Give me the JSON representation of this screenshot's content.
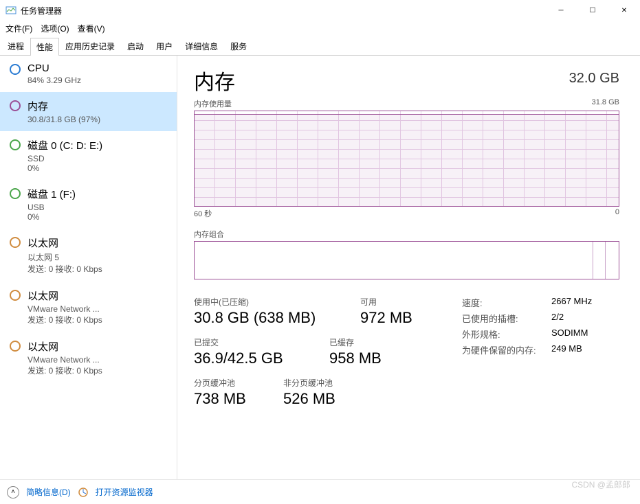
{
  "window": {
    "title": "任务管理器"
  },
  "menu": {
    "file": "文件(F)",
    "options": "选项(O)",
    "view": "查看(V)"
  },
  "tabs": [
    "进程",
    "性能",
    "应用历史记录",
    "启动",
    "用户",
    "详细信息",
    "服务"
  ],
  "active_tab": 1,
  "sidebar": [
    {
      "ind": "blue",
      "title": "CPU",
      "sub": "84% 3.29 GHz"
    },
    {
      "ind": "purple",
      "title": "内存",
      "sub": "30.8/31.8 GB (97%)"
    },
    {
      "ind": "green",
      "title": "磁盘 0 (C: D: E:)",
      "sub": "SSD",
      "sub2": "0%"
    },
    {
      "ind": "green",
      "title": "磁盘 1 (F:)",
      "sub": "USB",
      "sub2": "0%"
    },
    {
      "ind": "orange",
      "title": "以太网",
      "sub": "以太网 5",
      "sub2": "发送: 0 接收: 0 Kbps"
    },
    {
      "ind": "orange",
      "title": "以太网",
      "sub": "VMware Network ...",
      "sub2": "发送: 0 接收: 0 Kbps"
    },
    {
      "ind": "orange",
      "title": "以太网",
      "sub": "VMware Network ...",
      "sub2": "发送: 0 接收: 0 Kbps"
    }
  ],
  "selected_sidebar": 1,
  "main": {
    "title": "内存",
    "total": "32.0 GB",
    "usage_label": "内存使用量",
    "usage_max": "31.8 GB",
    "x_left": "60 秒",
    "x_right": "0",
    "comp_label": "内存组合",
    "stats": {
      "in_use_label": "使用中(已压缩)",
      "in_use": "30.8 GB (638 MB)",
      "available_label": "可用",
      "available": "972 MB",
      "committed_label": "已提交",
      "committed": "36.9/42.5 GB",
      "cached_label": "已缓存",
      "cached": "958 MB",
      "paged_label": "分页缓冲池",
      "paged": "738 MB",
      "nonpaged_label": "非分页缓冲池",
      "nonpaged": "526 MB"
    },
    "info": {
      "speed_l": "速度:",
      "speed_v": "2667 MHz",
      "slots_l": "已使用的插槽:",
      "slots_v": "2/2",
      "form_l": "外形规格:",
      "form_v": "SODIMM",
      "reserved_l": "为硬件保留的内存:",
      "reserved_v": "249 MB"
    }
  },
  "footer": {
    "brief": "简略信息(D)",
    "monitor": "打开资源监视器"
  },
  "watermark": "CSDN @孟郎郎",
  "chart_data": {
    "type": "area",
    "title": "内存使用量",
    "x_range_seconds": [
      60,
      0
    ],
    "ylim": [
      0,
      31.8
    ],
    "ylabel": "GB",
    "series": [
      {
        "name": "used",
        "approx_constant_value": 30.8
      }
    ]
  }
}
